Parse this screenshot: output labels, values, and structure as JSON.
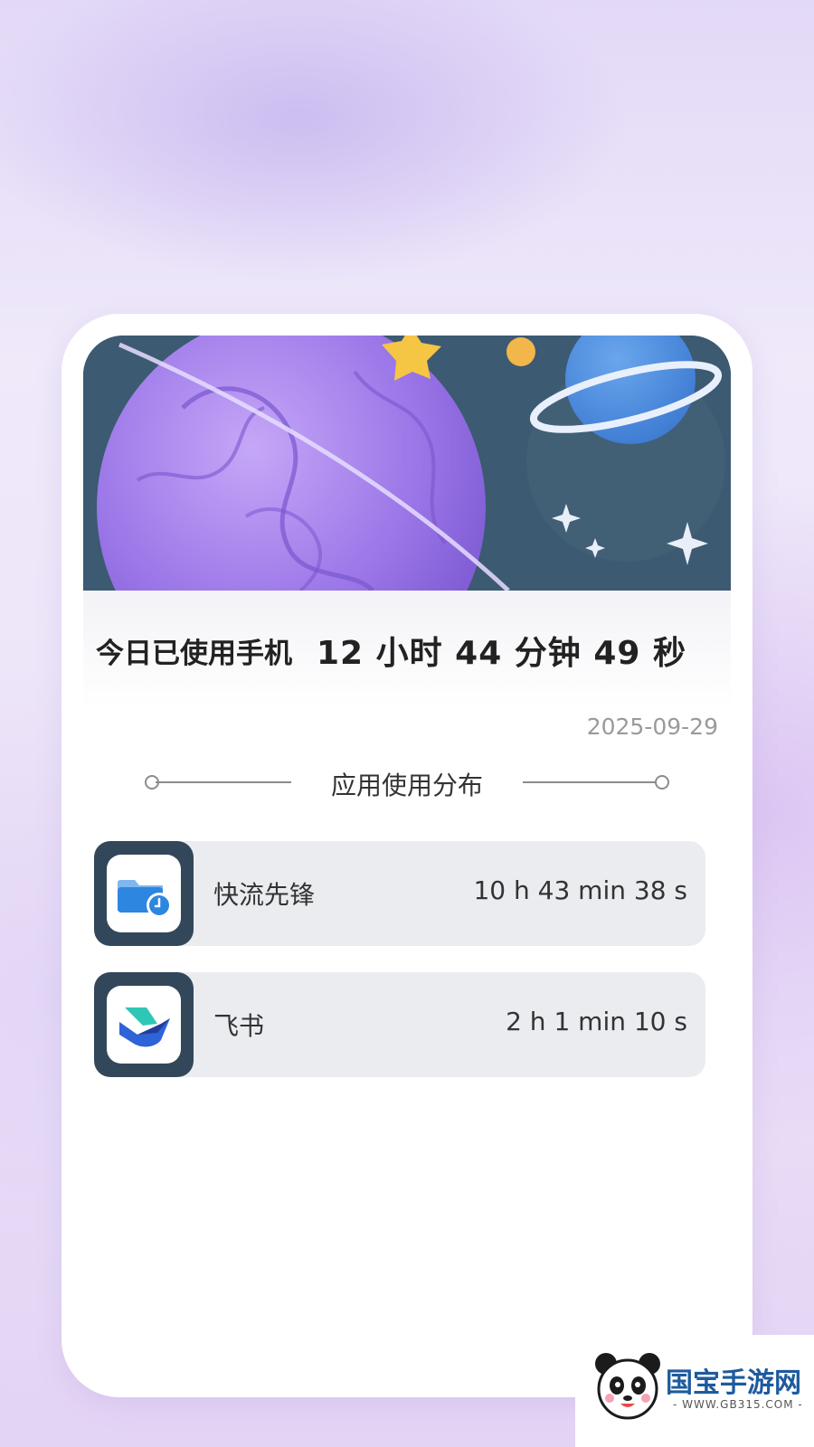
{
  "usage_summary": {
    "label": "今日已使用手机",
    "duration": "12 小时 44 分钟 49 秒",
    "date": "2025-09-29"
  },
  "section": {
    "title": "应用使用分布"
  },
  "apps": [
    {
      "name": "快流先锋",
      "time": "10 h 43 min 38 s",
      "icon": "folder-clock-icon"
    },
    {
      "name": "飞书",
      "time": "2 h 1 min 10 s",
      "icon": "feishu-bird-icon"
    }
  ],
  "watermark": {
    "name": "国宝手游网",
    "url": "- WWW.GB315.COM -"
  },
  "colors": {
    "banner_bg": "#3c5a72",
    "icon_box": "#33475a",
    "row_bg": "#ebecf0",
    "text_dark": "#222222",
    "date_gray": "#9a9a9a"
  }
}
